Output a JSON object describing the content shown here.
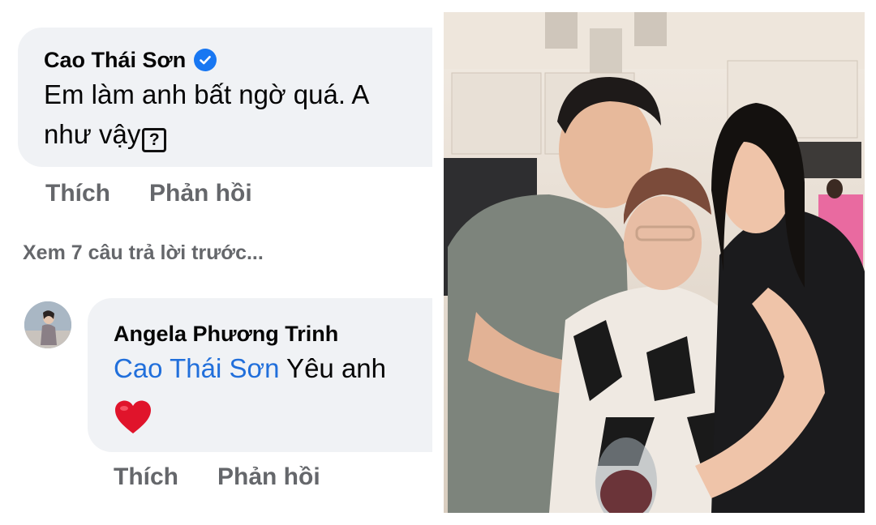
{
  "comment1": {
    "author": "Cao Thái Sơn",
    "line1": "Em làm anh bất ngờ quá. A",
    "line2": "như vậy",
    "unknown_glyph": "?",
    "like_label": "Thích",
    "reply_label": "Phản hồi"
  },
  "view_previous": "Xem 7 câu trả lời trước...",
  "comment2": {
    "author": "Angela Phương Trinh",
    "mention": "Cao Thái Sơn",
    "text": " Yêu anh",
    "emoji": "red-heart",
    "like_label": "Thích",
    "reply_label": "Phản hồi"
  },
  "icons": {
    "verified": "verified-badge-icon",
    "heart": "red-heart-icon"
  },
  "colors": {
    "bubble_bg": "#f0f2f5",
    "action_gray": "#65676b",
    "mention_blue": "#216fdb",
    "verified_blue": "#1877f2",
    "heart_red": "#e0142b"
  }
}
